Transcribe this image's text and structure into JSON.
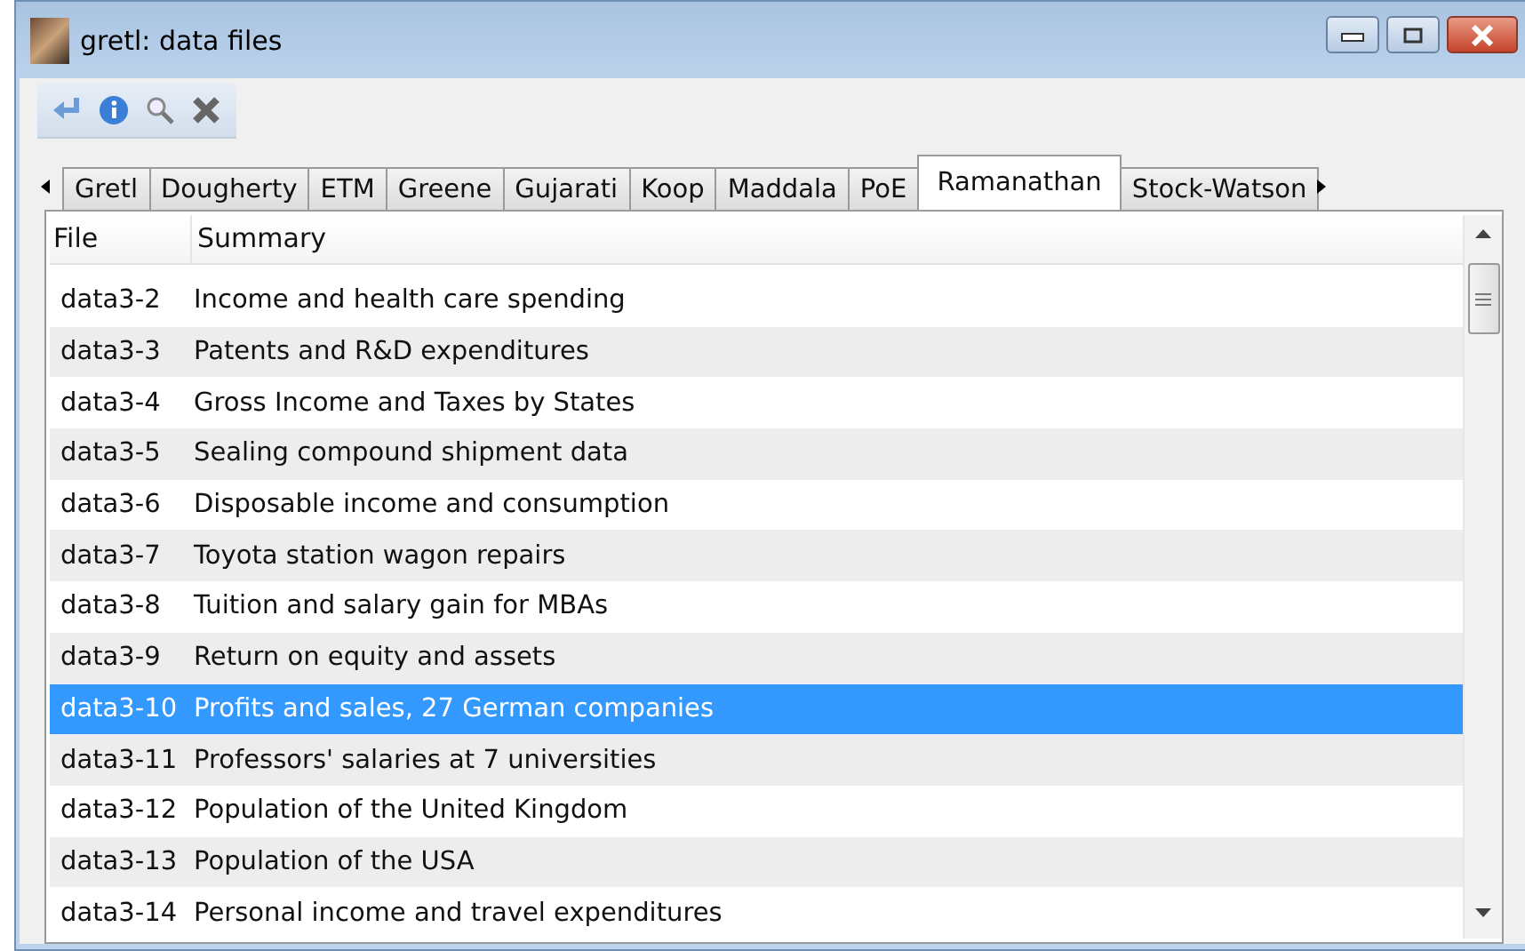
{
  "window": {
    "title": "gretl: data files"
  },
  "toolbar": {
    "buttons": [
      {
        "kind": "open"
      },
      {
        "kind": "info"
      },
      {
        "kind": "search"
      },
      {
        "kind": "close"
      }
    ]
  },
  "tabs": [
    {
      "label": "Gretl",
      "selected": false
    },
    {
      "label": "Dougherty",
      "selected": false
    },
    {
      "label": "ETM",
      "selected": false
    },
    {
      "label": "Greene",
      "selected": false
    },
    {
      "label": "Gujarati",
      "selected": false
    },
    {
      "label": "Koop",
      "selected": false
    },
    {
      "label": "Maddala",
      "selected": false
    },
    {
      "label": "PoE",
      "selected": false
    },
    {
      "label": "Ramanathan",
      "selected": true
    },
    {
      "label": "Stock-Watson",
      "selected": false
    }
  ],
  "table": {
    "columns": [
      "File",
      "Summary"
    ],
    "rows": [
      {
        "file": "data3-2",
        "summary": "Income and health care spending",
        "selected": false
      },
      {
        "file": "data3-3",
        "summary": "Patents and R&D expenditures",
        "selected": false
      },
      {
        "file": "data3-4",
        "summary": "Gross Income and Taxes by States",
        "selected": false
      },
      {
        "file": "data3-5",
        "summary": "Sealing compound shipment data",
        "selected": false
      },
      {
        "file": "data3-6",
        "summary": "Disposable income and consumption",
        "selected": false
      },
      {
        "file": "data3-7",
        "summary": "Toyota station wagon repairs",
        "selected": false
      },
      {
        "file": "data3-8",
        "summary": "Tuition and salary gain for MBAs",
        "selected": false
      },
      {
        "file": "data3-9",
        "summary": "Return on equity and assets",
        "selected": false
      },
      {
        "file": "data3-10",
        "summary": "Profits and sales, 27 German companies",
        "selected": true
      },
      {
        "file": "data3-11",
        "summary": "Professors' salaries at 7 universities",
        "selected": false
      },
      {
        "file": "data3-12",
        "summary": "Population of the United Kingdom",
        "selected": false
      },
      {
        "file": "data3-13",
        "summary": "Population of the USA",
        "selected": false
      },
      {
        "file": "data3-14",
        "summary": "Personal income and travel expenditures",
        "selected": false
      }
    ]
  }
}
